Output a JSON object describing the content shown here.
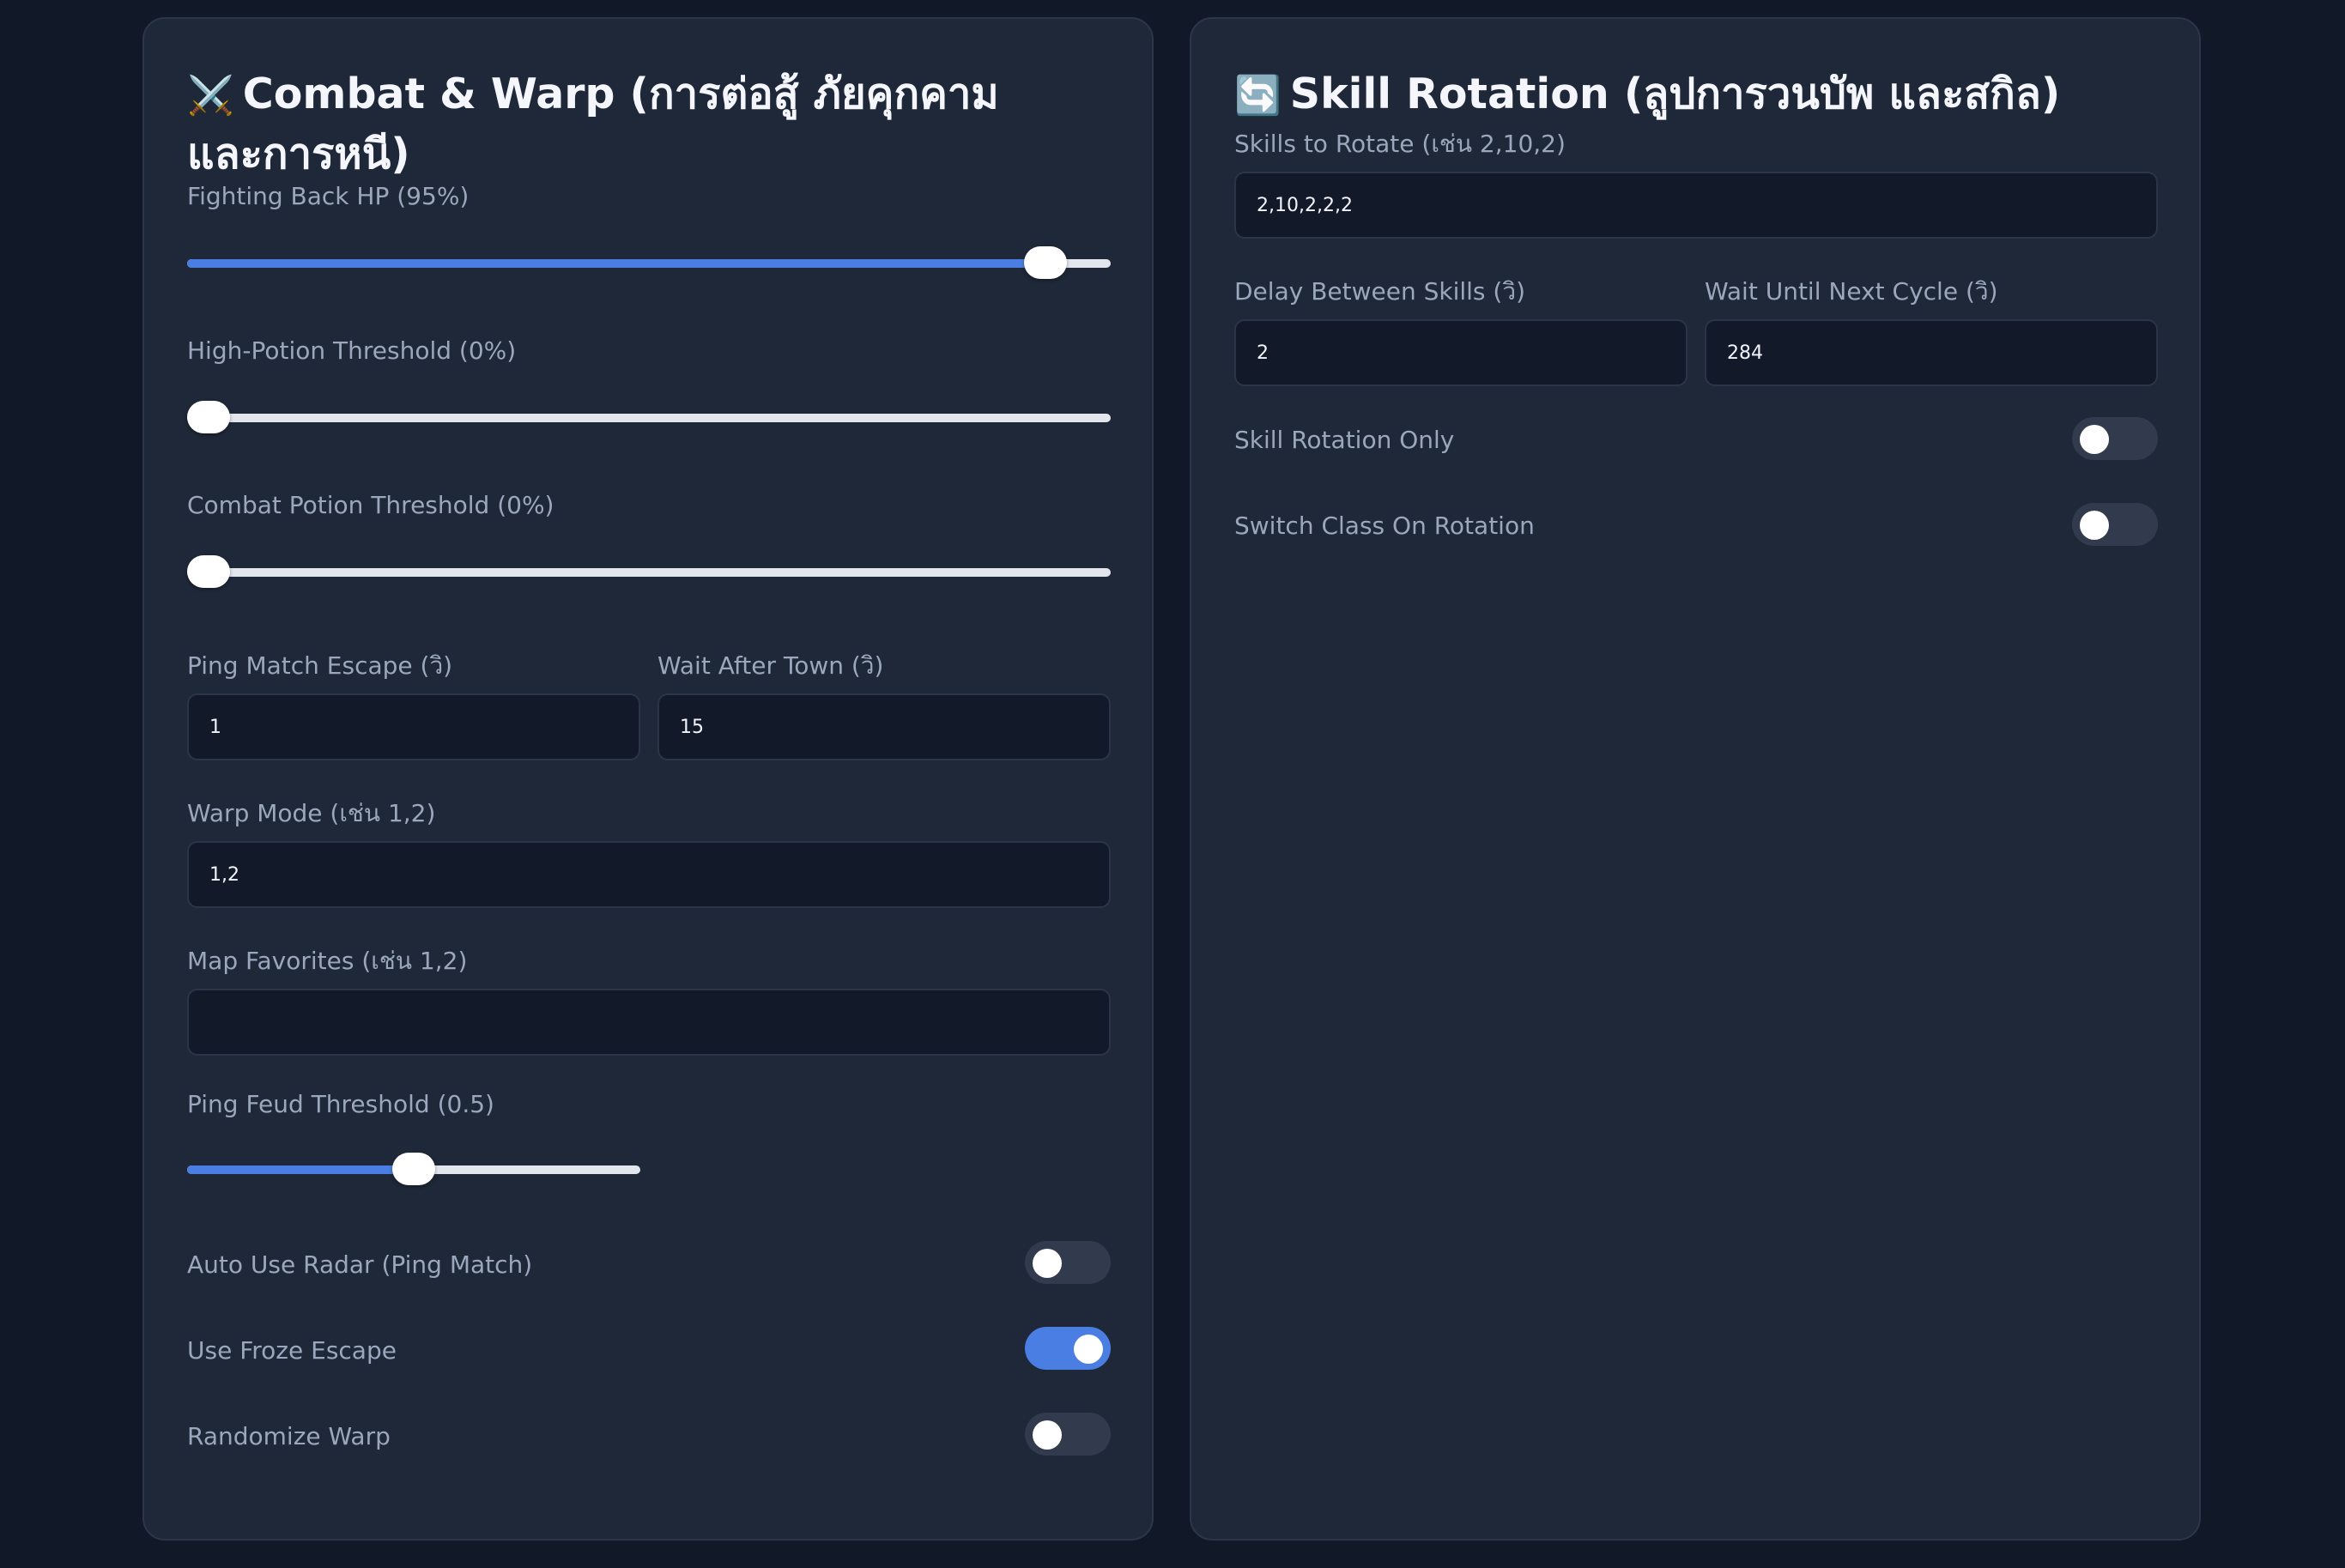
{
  "combat": {
    "emoji": "⚔️",
    "title": "Combat & Warp (การต่อสู้ ภัยคุกคาม และการหนี)",
    "fighting_back_hp": {
      "label": "Fighting Back HP (95%)",
      "value": 0.95
    },
    "high_potion": {
      "label": "High-Potion Threshold (0%)",
      "value": 0
    },
    "combat_potion": {
      "label": "Combat Potion Threshold (0%)",
      "value": 0
    },
    "ping_match_escape": {
      "label": "Ping Match Escape (วิ)",
      "value": "1"
    },
    "wait_after_town": {
      "label": "Wait After Town (วิ)",
      "value": "15"
    },
    "warp_mode": {
      "label": "Warp Mode (เช่น 1,2)",
      "value": "1,2"
    },
    "map_favorites": {
      "label": "Map Favorites (เช่น 1,2)",
      "value": ""
    },
    "ping_feud": {
      "label": "Ping Feud Threshold (0.5)",
      "value": 0.5
    },
    "auto_use_radar": {
      "label": "Auto Use Radar (Ping Match)",
      "on": false
    },
    "use_froze_escape": {
      "label": "Use Froze Escape",
      "on": true
    },
    "randomize_warp": {
      "label": "Randomize Warp",
      "on": false
    }
  },
  "rotation": {
    "emoji": "🔄",
    "title": "Skill Rotation (ลูปการวนบัพ และสกิล)",
    "skills_to_rotate": {
      "label": "Skills to Rotate (เช่น 2,10,2)",
      "value": "2,10,2,2,2"
    },
    "delay_between_skills": {
      "label": "Delay Between Skills (วิ)",
      "value": "2"
    },
    "wait_until_next_cycle": {
      "label": "Wait Until Next Cycle (วิ)",
      "value": "284"
    },
    "skill_rotation_only": {
      "label": "Skill Rotation Only",
      "on": false
    },
    "switch_class_on_rotation": {
      "label": "Switch Class On Rotation",
      "on": false
    }
  },
  "colors": {
    "accent": "#4a7ee3",
    "background": "#111828",
    "panel": "#1f2839",
    "input": "#121a2a"
  }
}
